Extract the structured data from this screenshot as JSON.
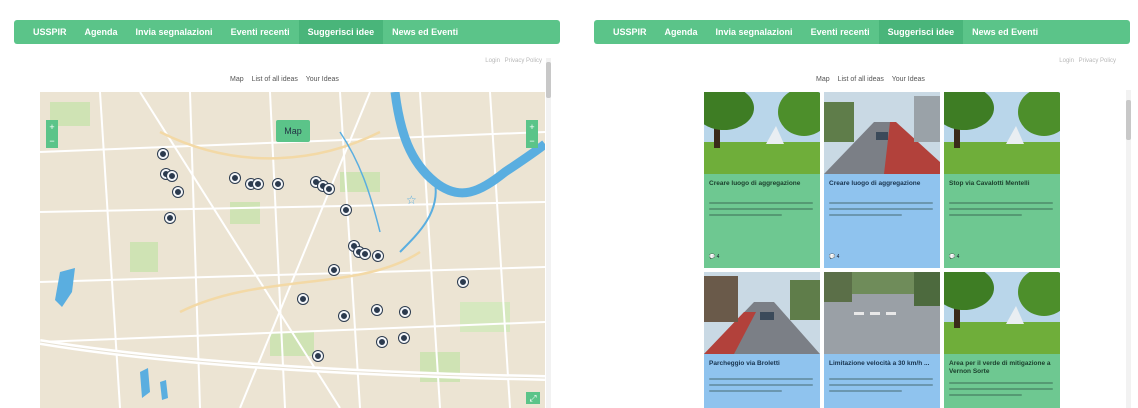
{
  "nav": {
    "items": [
      "USSPIR",
      "Agenda",
      "Invia segnalazioni",
      "Eventi recenti",
      "Suggerisci idee",
      "News ed Eventi"
    ],
    "active_index": 4
  },
  "top_links": [
    "Login",
    "Privacy Policy"
  ],
  "subnav": [
    "Map",
    "List of all ideas",
    "Your Ideas"
  ],
  "map": {
    "label": "Map",
    "zoom_in": "+",
    "zoom_out": "−",
    "fullscreen": "⤢"
  },
  "cards": [
    {
      "title": "Creare luogo di aggregazione",
      "count": "4",
      "color": "green",
      "image": "park"
    },
    {
      "title": "Creare luogo di aggregazione",
      "count": "4",
      "color": "blue",
      "image": "street"
    },
    {
      "title": "Stop via Cavalotti Mentelli",
      "count": "4",
      "color": "green",
      "image": "park"
    },
    {
      "title": "Parcheggio via Broletti",
      "count": "",
      "color": "blue",
      "image": "street"
    },
    {
      "title": "Limitazione velocità a 30 km/h ...",
      "count": "",
      "color": "blue",
      "image": "road"
    },
    {
      "title": "Area per il verde di mitigazione a Vernon Sorte",
      "count": "",
      "color": "green",
      "image": "park"
    }
  ],
  "colors": {
    "nav_green": "#5bc489",
    "card_green": "#6ec891",
    "card_blue": "#8fc3ee",
    "marker": "#2b3a4e",
    "river": "#5aaee0"
  }
}
